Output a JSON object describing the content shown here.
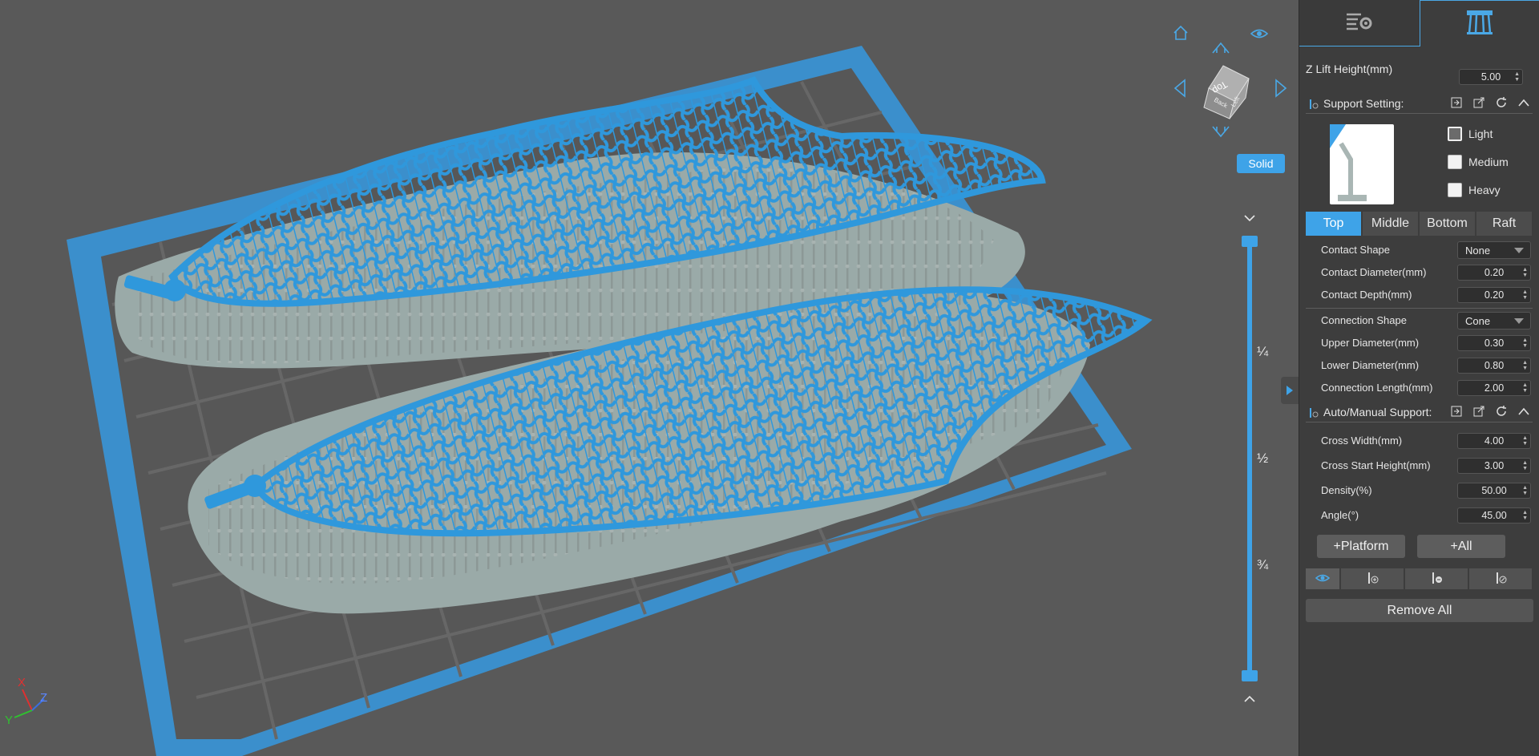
{
  "viewport": {
    "render_mode": "Solid",
    "slider_fractions": [
      "¼",
      "½",
      "¾"
    ],
    "axes": {
      "x": "X",
      "y": "Y",
      "z": "Z"
    },
    "view_cube_labels": {
      "top": "Top",
      "back": "Back",
      "left": "Left"
    },
    "icons": [
      "home-icon",
      "eye-icon",
      "arrow-up-icon",
      "arrow-left-icon",
      "arrow-right-icon",
      "arrow-down-icon",
      "chevron-down-icon",
      "chevron-up-icon",
      "collapse-panel-icon"
    ]
  },
  "panel": {
    "tabs": [
      {
        "icon": "settings-list-icon"
      },
      {
        "icon": "support-structure-icon"
      }
    ],
    "z_lift": {
      "label": "Z Lift Height(mm)",
      "value": "5.00"
    },
    "support_setting": {
      "title": "Support Setting:",
      "presets": [
        {
          "label": "Light",
          "checked": true
        },
        {
          "label": "Medium",
          "checked": false
        },
        {
          "label": "Heavy",
          "checked": false
        }
      ],
      "tabs": [
        "Top",
        "Middle",
        "Bottom",
        "Raft"
      ],
      "active_tab": "Top",
      "contact_shape": {
        "label": "Contact Shape",
        "value": "None"
      },
      "contact_diameter": {
        "label": "Contact Diameter(mm)",
        "value": "0.20"
      },
      "contact_depth": {
        "label": "Contact Depth(mm)",
        "value": "0.20"
      },
      "connection_shape": {
        "label": "Connection Shape",
        "value": "Cone"
      },
      "upper_diameter": {
        "label": "Upper Diameter(mm)",
        "value": "0.30"
      },
      "lower_diameter": {
        "label": "Lower Diameter(mm)",
        "value": "0.80"
      },
      "connection_length": {
        "label": "Connection Length(mm)",
        "value": "2.00"
      }
    },
    "auto_manual": {
      "title": "Auto/Manual Support:",
      "cross_width": {
        "label": "Cross Width(mm)",
        "value": "4.00"
      },
      "cross_start": {
        "label": "Cross Start Height(mm)",
        "value": "3.00"
      },
      "density": {
        "label": "Density(%)",
        "value": "50.00"
      },
      "angle": {
        "label": "Angle(°)",
        "value": "45.00"
      },
      "platform_button": "+Platform",
      "all_button": "+All",
      "remove_all": "Remove All"
    }
  },
  "colors": {
    "accent": "#3ea3e8",
    "model": "#2e95d9",
    "support": "#9aaaa8",
    "viewport_bg": "#595959",
    "panel_bg": "#3d3d3d"
  }
}
